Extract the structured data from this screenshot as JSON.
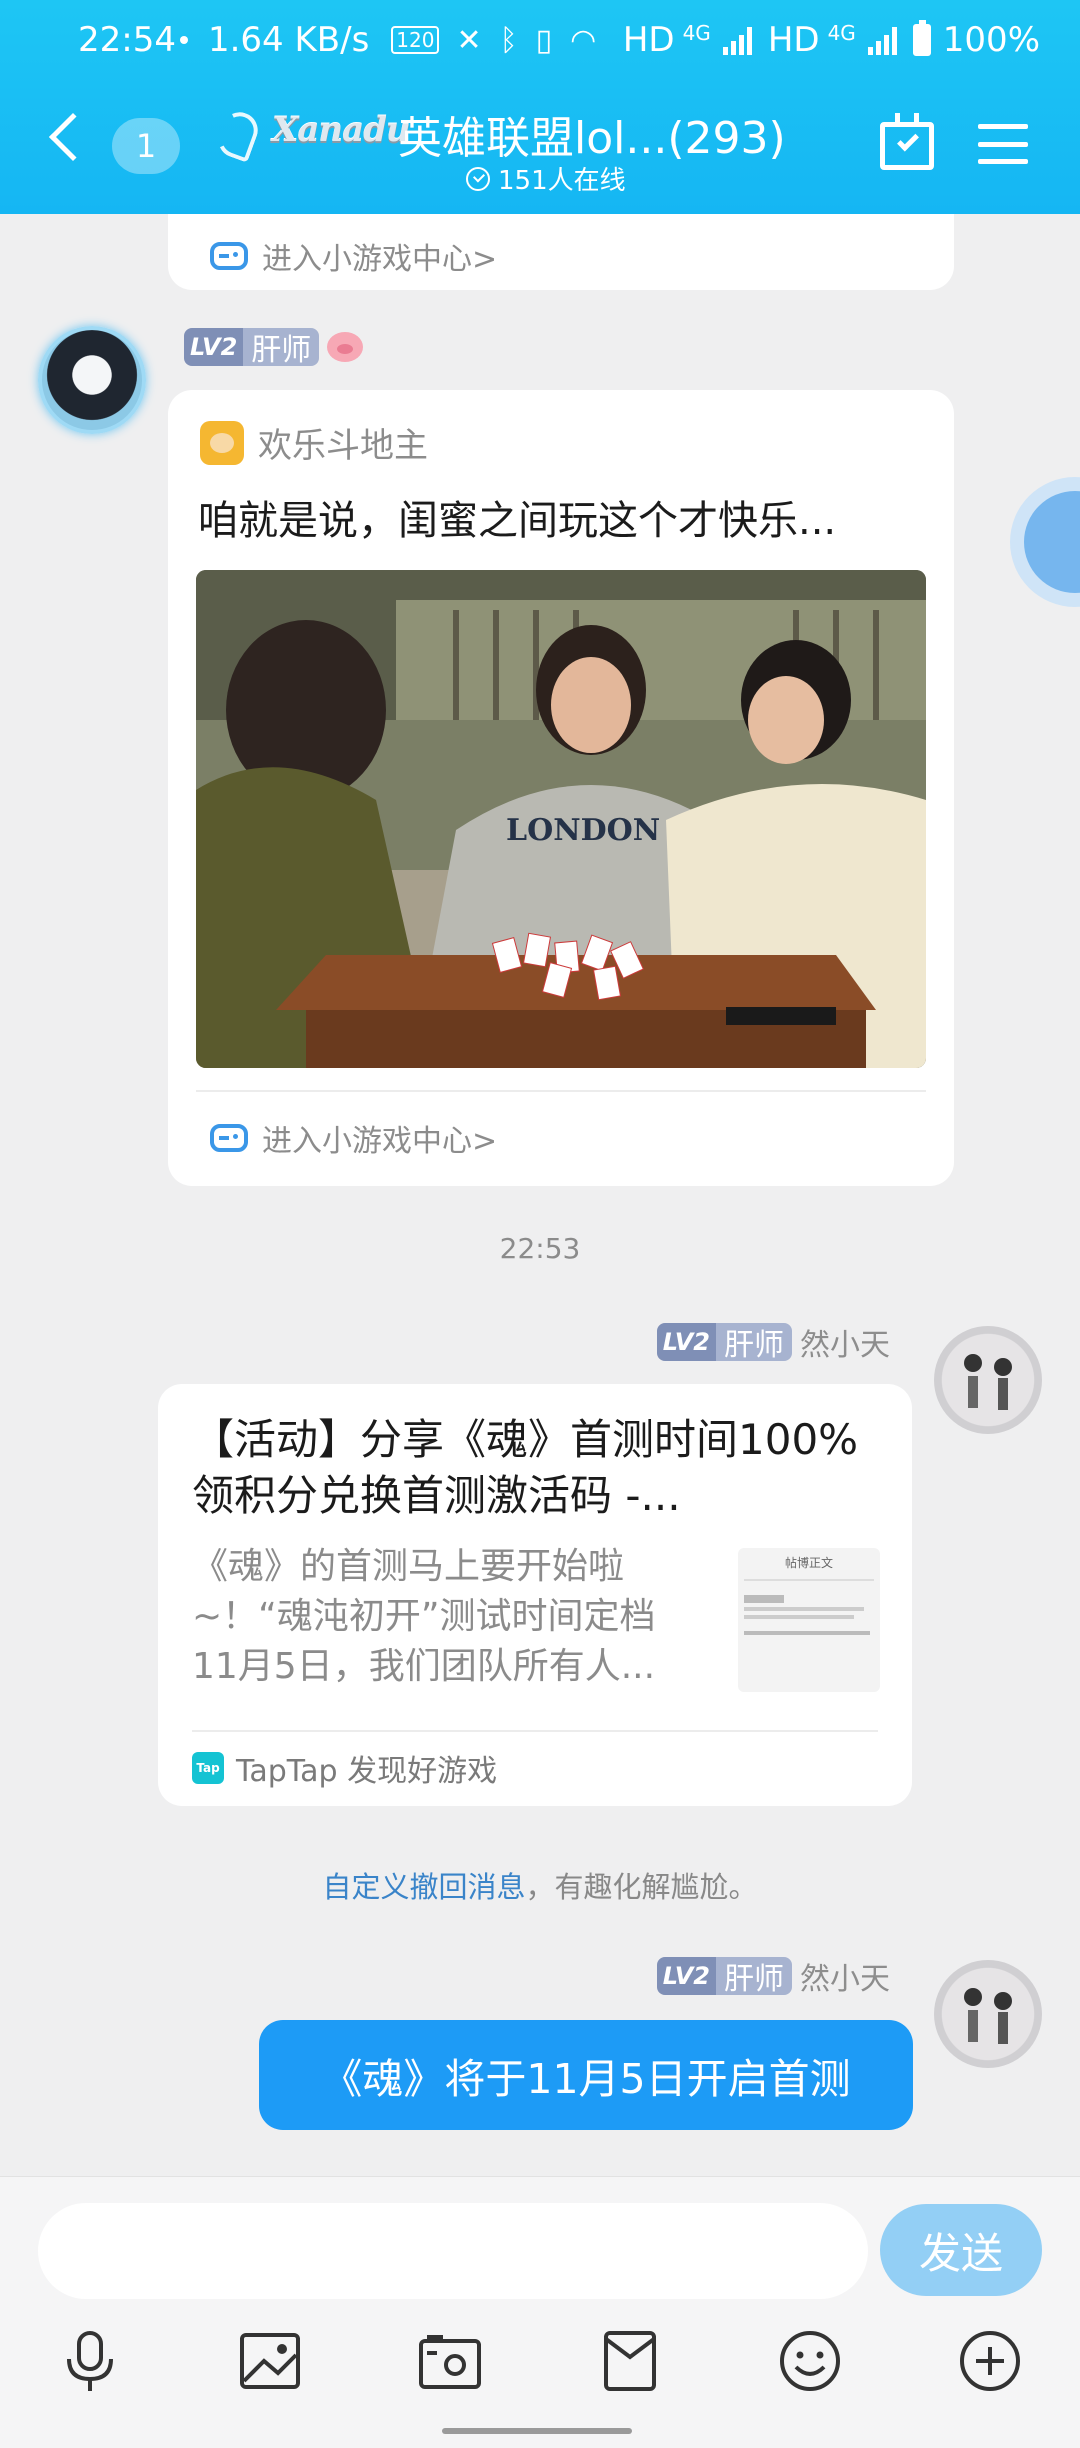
{
  "status_bar": {
    "time": "22:54",
    "speed": "1.64 KB/s",
    "refresh_rate": "120",
    "hd1": "HD",
    "net1": "4G",
    "hd2": "HD",
    "net2": "4G",
    "battery": "100%"
  },
  "header": {
    "unread_count": "1",
    "title_tag": "Xanadu",
    "title": "英雄联盟lol...(293)",
    "online": "151人在线"
  },
  "messages": {
    "card1_partial": {
      "game_center_link": "进入小游戏中心>"
    },
    "card2": {
      "sender_level": "LV2",
      "sender_title": "肝师",
      "game_name": "欢乐斗地主",
      "headline": "咱就是说，闺蜜之间玩这个才快乐...",
      "image_word": "LONDON",
      "game_center_link": "进入小游戏中心>"
    },
    "timestamp": "22:53",
    "share": {
      "sender_level": "LV2",
      "sender_title": "肝师",
      "sender_name": "然小天",
      "title": "【活动】分享《魂》首测时间100%领积分兑换首测激活码 -...",
      "description": "《魂》的首测马上要开始啦~！“魂沌初开”测试时间定档11月5日，我们团队所有人...",
      "thumb_heading": "帖博正文",
      "source_badge": "Tap",
      "source": "TapTap 发现好游戏"
    },
    "system": {
      "link_text": "自定义撤回消息",
      "rest_text": "，有趣化解尴尬。"
    },
    "text_msg": {
      "sender_level": "LV2",
      "sender_title": "肝师",
      "sender_name": "然小天",
      "text": "《魂》将于11月5日开启首测"
    }
  },
  "input": {
    "placeholder": "",
    "send_label": "发送"
  },
  "toolbar": [
    "microphone-icon",
    "image-icon",
    "camera-icon",
    "red-packet-icon",
    "emoji-icon",
    "plus-icon"
  ]
}
